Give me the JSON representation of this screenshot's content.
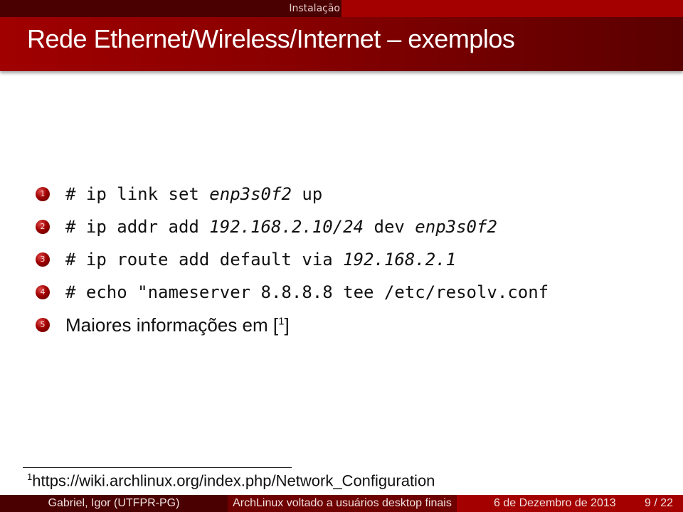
{
  "header": {
    "section": "Instalação",
    "title": "Rede Ethernet/Wireless/Internet – exemplos"
  },
  "list": [
    {
      "number": "1",
      "parts": [
        {
          "text": "# ip link set ",
          "italic": false
        },
        {
          "text": "enp3s0f2",
          "italic": true
        },
        {
          "text": " up",
          "italic": false
        }
      ],
      "type": "code"
    },
    {
      "number": "2",
      "parts": [
        {
          "text": "# ip addr add ",
          "italic": false
        },
        {
          "text": "192.168.2.10/24",
          "italic": true
        },
        {
          "text": " dev ",
          "italic": false
        },
        {
          "text": "enp3s0f2",
          "italic": true
        }
      ],
      "type": "code"
    },
    {
      "number": "3",
      "parts": [
        {
          "text": "# ip route add default via ",
          "italic": false
        },
        {
          "text": "192.168.2.1",
          "italic": true
        }
      ],
      "type": "code"
    },
    {
      "number": "4",
      "parts": [
        {
          "text": "# echo \"nameserver 8.8.8.8 tee /etc/resolv.conf",
          "italic": false
        }
      ],
      "type": "code"
    },
    {
      "number": "5",
      "text": "Maiores informações em [",
      "footnote_ref": "1",
      "text_after": "]",
      "type": "text"
    }
  ],
  "footnote": {
    "mark": "1",
    "text": "https://wiki.archlinux.org/index.php/Network_Configuration"
  },
  "footer": {
    "author": "Gabriel, Igor  (UTFPR-PG)",
    "talk_title": "ArchLinux voltado a usuários desktop finais",
    "date": "6 de Dezembro de 2013",
    "page": "9 / 22"
  },
  "colors": {
    "dark_red": "#4a0000",
    "mid_red": "#6e0000",
    "bright_red": "#a50000"
  }
}
